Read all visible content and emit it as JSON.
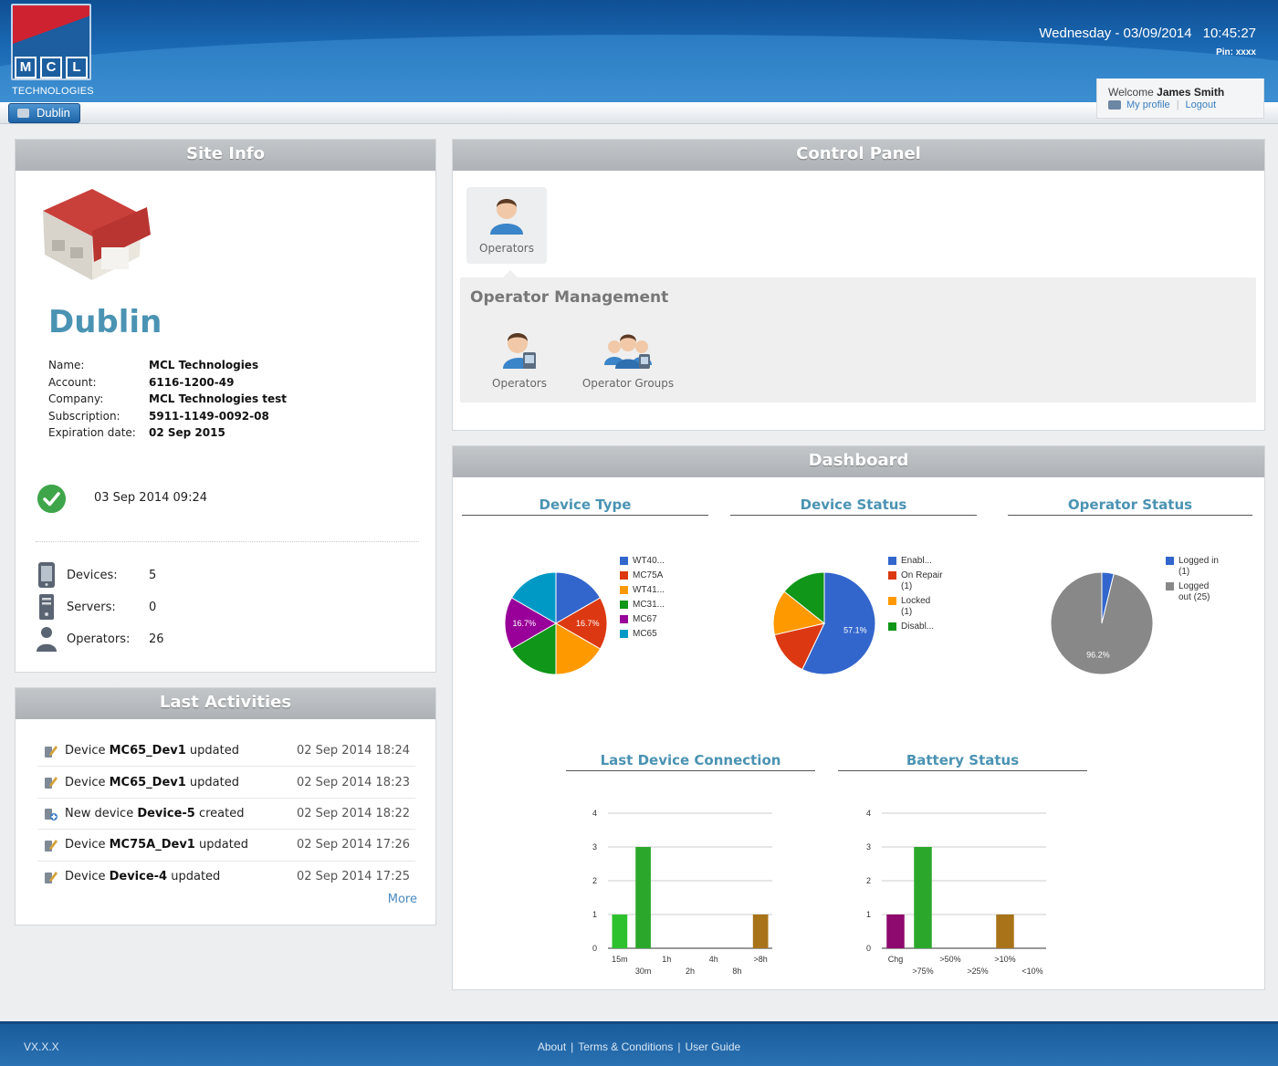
{
  "header": {
    "logo_letters": [
      "M",
      "C",
      "L"
    ],
    "logo_subtitle": "TECHNOLOGIES",
    "date": "Wednesday - 03/09/2014",
    "time": "10:45:27",
    "pin": "Pin: xxxx",
    "welcome_prefix": "Welcome",
    "user_name": "James Smith",
    "my_profile": "My profile",
    "logout": "Logout",
    "site_button": "Dublin"
  },
  "site_info": {
    "title": "Site Info",
    "site_name": "Dublin",
    "fields": [
      {
        "label": "Name:",
        "value": "MCL Technologies"
      },
      {
        "label": "Account:",
        "value": "6116-1200-49"
      },
      {
        "label": "Company:",
        "value": "MCL Technologies test"
      },
      {
        "label": "Subscription:",
        "value": "5911-1149-0092-08"
      },
      {
        "label": "Expiration date:",
        "value": "02 Sep 2015"
      }
    ],
    "check_time": "03 Sep 2014 09:24",
    "stats": [
      {
        "label": "Devices:",
        "value": "5",
        "icon": "device-icon"
      },
      {
        "label": "Servers:",
        "value": "0",
        "icon": "server-icon"
      },
      {
        "label": "Operators:",
        "value": "26",
        "icon": "operator-icon"
      }
    ]
  },
  "last_activities": {
    "title": "Last Activities",
    "items": [
      {
        "prefix": "Device ",
        "bold": "MC65_Dev1",
        "suffix": " updated",
        "date": "02 Sep 2014 18:24"
      },
      {
        "prefix": "Device ",
        "bold": "MC65_Dev1",
        "suffix": " updated",
        "date": "02 Sep 2014 18:23"
      },
      {
        "prefix": "New device ",
        "bold": "Device-5",
        "suffix": " created",
        "date": "02 Sep 2014 18:22"
      },
      {
        "prefix": "Device ",
        "bold": "MC75A_Dev1",
        "suffix": " updated",
        "date": "02 Sep 2014 17:26"
      },
      {
        "prefix": "Device ",
        "bold": "Device-4",
        "suffix": " updated",
        "date": "02 Sep 2014 17:25"
      }
    ],
    "more": "More"
  },
  "control_panel": {
    "title": "Control Panel",
    "tile_label": "Operators",
    "section_title": "Operator Management",
    "items": [
      {
        "label": "Operators"
      },
      {
        "label": "Operator Groups"
      }
    ]
  },
  "dashboard": {
    "title": "Dashboard",
    "chart_titles": {
      "device_type": "Device Type",
      "device_status": "Device Status",
      "operator_status": "Operator Status",
      "last_connection": "Last Device Connection",
      "battery": "Battery Status"
    }
  },
  "chart_data": [
    {
      "type": "pie",
      "title": "Device Type",
      "labels": [
        "WT40...",
        "MC75A",
        "WT41...",
        "MC31...",
        "MC67",
        "MC65"
      ],
      "values": [
        16.7,
        16.7,
        16.7,
        16.7,
        16.7,
        16.7
      ],
      "colors": [
        "#3366cc",
        "#dc3912",
        "#ff9900",
        "#109618",
        "#990099",
        "#0099c6"
      ],
      "data_labels": [
        "",
        "16.7%",
        "",
        "",
        "16.7%",
        ""
      ]
    },
    {
      "type": "pie",
      "title": "Device Status",
      "labels": [
        "Enabl...",
        "On Repair (1)",
        "Locked (1)",
        "Disabl..."
      ],
      "values": [
        57.1,
        14.3,
        14.3,
        14.3
      ],
      "colors": [
        "#3366cc",
        "#dc3912",
        "#ff9900",
        "#109618"
      ],
      "data_labels": [
        "57.1%",
        "",
        "",
        ""
      ]
    },
    {
      "type": "pie",
      "title": "Operator Status",
      "labels": [
        "Logged in (1)",
        "Logged out (25)"
      ],
      "values": [
        3.8,
        96.2
      ],
      "colors": [
        "#3366cc",
        "#888888"
      ],
      "data_labels": [
        "",
        "96.2%"
      ]
    },
    {
      "type": "bar",
      "title": "Last Device Connection",
      "categories": [
        "15m",
        "30m",
        "1h",
        "2h",
        "4h",
        "8h",
        ">8h"
      ],
      "values": [
        1,
        3,
        0,
        0,
        0,
        0,
        1
      ],
      "colors": [
        "#2ec12e",
        "#2ba82b",
        "#2ba82b",
        "#2ba82b",
        "#2ba82b",
        "#2ba82b",
        "#a87319"
      ],
      "ylim": [
        0,
        4
      ],
      "yticks": [
        "0",
        "1",
        "2",
        "3",
        "4"
      ]
    },
    {
      "type": "bar",
      "title": "Battery Status",
      "categories": [
        "Chg",
        ">75%",
        ">50%",
        ">25%",
        ">10%",
        "<10%"
      ],
      "values": [
        1,
        3,
        0,
        0,
        1,
        0
      ],
      "colors": [
        "#8e0a6e",
        "#2ba82b",
        "#2ba82b",
        "#2ba82b",
        "#a87319",
        "#a87319"
      ],
      "ylim": [
        0,
        4
      ],
      "yticks": [
        "0",
        "1",
        "2",
        "3",
        "4"
      ]
    }
  ],
  "footer": {
    "version": "VX.X.X",
    "links": [
      "About",
      "Terms & Conditions",
      "User Guide"
    ]
  }
}
